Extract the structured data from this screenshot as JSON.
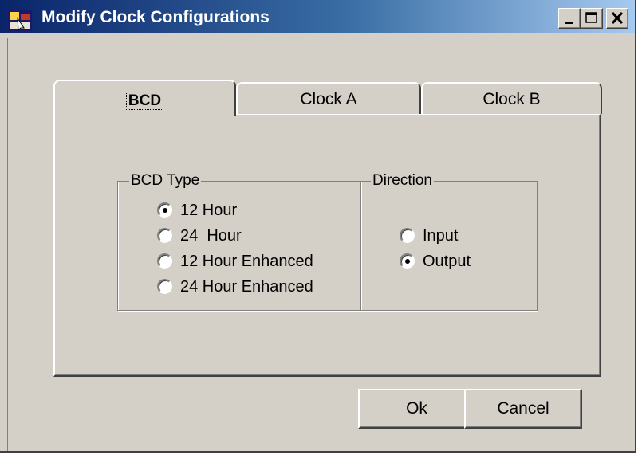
{
  "window": {
    "title": "Modify Clock Configurations",
    "icon": "app-icon",
    "controls": [
      "minimize-icon",
      "maximize-icon",
      "close-icon"
    ]
  },
  "tabs": [
    {
      "label": "BCD",
      "selected": true
    },
    {
      "label": "Clock A",
      "selected": false
    },
    {
      "label": "Clock B",
      "selected": false
    }
  ],
  "bcd_type": {
    "title": "BCD Type",
    "options": [
      {
        "label": "12 Hour",
        "checked": true
      },
      {
        "label": "24  Hour",
        "checked": false
      },
      {
        "label": "12 Hour Enhanced",
        "checked": false
      },
      {
        "label": "24 Hour Enhanced",
        "checked": false
      }
    ]
  },
  "direction": {
    "title": "Direction",
    "options": [
      {
        "label": "Input",
        "checked": false
      },
      {
        "label": "Output",
        "checked": true
      }
    ]
  },
  "buttons": {
    "ok_label": "Ok",
    "cancel_label": "Cancel"
  },
  "colors": {
    "titlebar_start": "#0a246a",
    "titlebar_end": "#a6caf0",
    "face": "#d4d0c8"
  }
}
